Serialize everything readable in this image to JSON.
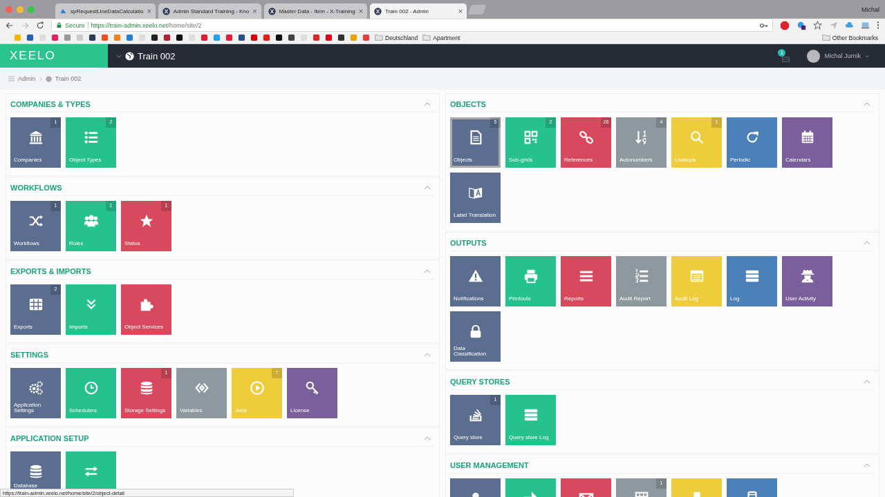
{
  "browser": {
    "tabs": [
      {
        "label": "spRequestLineDataCalculatio",
        "selected": false,
        "kind": "azure",
        "close": "×"
      },
      {
        "label": "Admin Standard Training - Kno",
        "selected": false,
        "kind": "xeelo",
        "close": "×"
      },
      {
        "label": "Master Data - Item - X-Training",
        "selected": false,
        "kind": "xeelo",
        "close": "×"
      },
      {
        "label": "Train 002 - Admin",
        "selected": true,
        "kind": "xeelo",
        "close": "×"
      }
    ],
    "profile": "Michal",
    "url": {
      "secure": "Secure",
      "host": "https://train-admin.xeelo.net",
      "path": "/home/site/2"
    },
    "bookmarks": [
      {
        "label": "Deutschland"
      },
      {
        "label": "Apartment"
      }
    ],
    "other_bookmarks": "Other Bookmarks"
  },
  "app": {
    "logo": "XEELO",
    "site": "Train 002",
    "notifications": "1",
    "user": "Michal Jurnik"
  },
  "breadcrumb": [
    "Admin",
    "Train 002"
  ],
  "columns": [
    [
      {
        "title": "COMPANIES & TYPES",
        "expanded": true,
        "tiles": [
          {
            "label": "Companies",
            "badge": "1",
            "color": "#5b6e8f",
            "kind": "bank"
          },
          {
            "label": "Object Types",
            "badge": "2",
            "color": "#26c28e",
            "kind": "list"
          }
        ]
      },
      {
        "title": "WORKFLOWS",
        "expanded": true,
        "tiles": [
          {
            "label": "Workflows",
            "badge": "1",
            "color": "#5b6e8f",
            "kind": "shuffle"
          },
          {
            "label": "Roles",
            "badge": "1",
            "color": "#26c28e",
            "kind": "users"
          },
          {
            "label": "Status",
            "badge": "1",
            "color": "#d9495e",
            "kind": "star"
          }
        ]
      },
      {
        "title": "EXPORTS & IMPORTS",
        "expanded": true,
        "tiles": [
          {
            "label": "Exports",
            "badge": "2",
            "color": "#5b6e8f",
            "kind": "table"
          },
          {
            "label": "Imports",
            "color": "#26c28e",
            "kind": "chevrons"
          },
          {
            "label": "Object Services",
            "color": "#d9495e",
            "kind": "puzzle"
          }
        ]
      },
      {
        "title": "SETTINGS",
        "expanded": true,
        "tiles": [
          {
            "label": "Application Settings",
            "color": "#5b6e8f",
            "kind": "gears"
          },
          {
            "label": "Schedulers",
            "color": "#26c28e",
            "kind": "clock"
          },
          {
            "label": "Storage Settings",
            "badge": "1",
            "color": "#d9495e",
            "kind": "database"
          },
          {
            "label": "Variables",
            "color": "#8e999f",
            "kind": "code"
          },
          {
            "label": "Jobs",
            "badge": "7",
            "color": "#efcc3c",
            "kind": "play"
          },
          {
            "label": "License",
            "color": "#7b5f9d",
            "kind": "key"
          }
        ]
      },
      {
        "title": "APPLICATION SETUP",
        "expanded": true,
        "tiles": [
          {
            "label": "Database",
            "color": "#5b6e8f",
            "kind": "database"
          },
          {
            "color": "#26c28e",
            "kind": "swap"
          }
        ]
      }
    ],
    [
      {
        "title": "OBJECTS",
        "expanded": true,
        "tiles": [
          {
            "label": "Objects",
            "badge": "5",
            "color": "#5b6e8f",
            "kind": "file",
            "hovered": true
          },
          {
            "label": "Sub-grids",
            "badge": "2",
            "color": "#26c28e",
            "kind": "qrcode"
          },
          {
            "label": "References",
            "badge": "26",
            "color": "#d9495e",
            "kind": "link"
          },
          {
            "label": "Autonumbers",
            "badge": "4",
            "color": "#8e999f",
            "kind": "sortnum"
          },
          {
            "label": "Lookups",
            "badge": "1",
            "color": "#efcc3c",
            "kind": "search"
          },
          {
            "label": "Periodic",
            "color": "#4c80b8",
            "kind": "refresh"
          },
          {
            "label": "Calendars",
            "color": "#7b5f9d",
            "kind": "calendar"
          },
          {
            "label": "Label Translation",
            "color": "#5b6e8f",
            "kind": "translate"
          }
        ]
      },
      {
        "title": "OUTPUTS",
        "expanded": true,
        "tiles": [
          {
            "label": "Notifications",
            "color": "#5b6e8f",
            "kind": "warning"
          },
          {
            "label": "Printouts",
            "color": "#26c28e",
            "kind": "print"
          },
          {
            "label": "Reports",
            "color": "#d9495e",
            "kind": "bars"
          },
          {
            "label": "Audit Report",
            "color": "#8e999f",
            "kind": "numlist"
          },
          {
            "label": "Audit Log",
            "color": "#efcc3c",
            "kind": "window"
          },
          {
            "label": "Log",
            "color": "#4c80b8",
            "kind": "servers"
          },
          {
            "label": "User Activity",
            "color": "#7b5f9d",
            "kind": "spy"
          },
          {
            "label": "Data Classification",
            "color": "#5b6e8f",
            "kind": "lock"
          }
        ]
      },
      {
        "title": "QUERY STORES",
        "expanded": true,
        "tiles": [
          {
            "label": "Query store",
            "badge": "1",
            "color": "#5b6e8f",
            "kind": "stack"
          },
          {
            "label": "Query store Log",
            "color": "#26c28e",
            "kind": "servers"
          }
        ]
      },
      {
        "title": "USER MANAGEMENT",
        "expanded": true,
        "tiles": [
          {
            "color": "#5b6e8f",
            "kind": "user"
          },
          {
            "color": "#26c28e",
            "kind": "arrow"
          },
          {
            "color": "#d9495e",
            "kind": "envelope"
          },
          {
            "badge": "1",
            "color": "#8e999f",
            "kind": "grid"
          },
          {
            "color": "#efcc3c",
            "kind": "pin"
          },
          {
            "color": "#4c80b8",
            "kind": "mobile"
          }
        ]
      }
    ]
  ],
  "status_url": "https://train-admin.xeelo.net/home/site/2/object-detail"
}
